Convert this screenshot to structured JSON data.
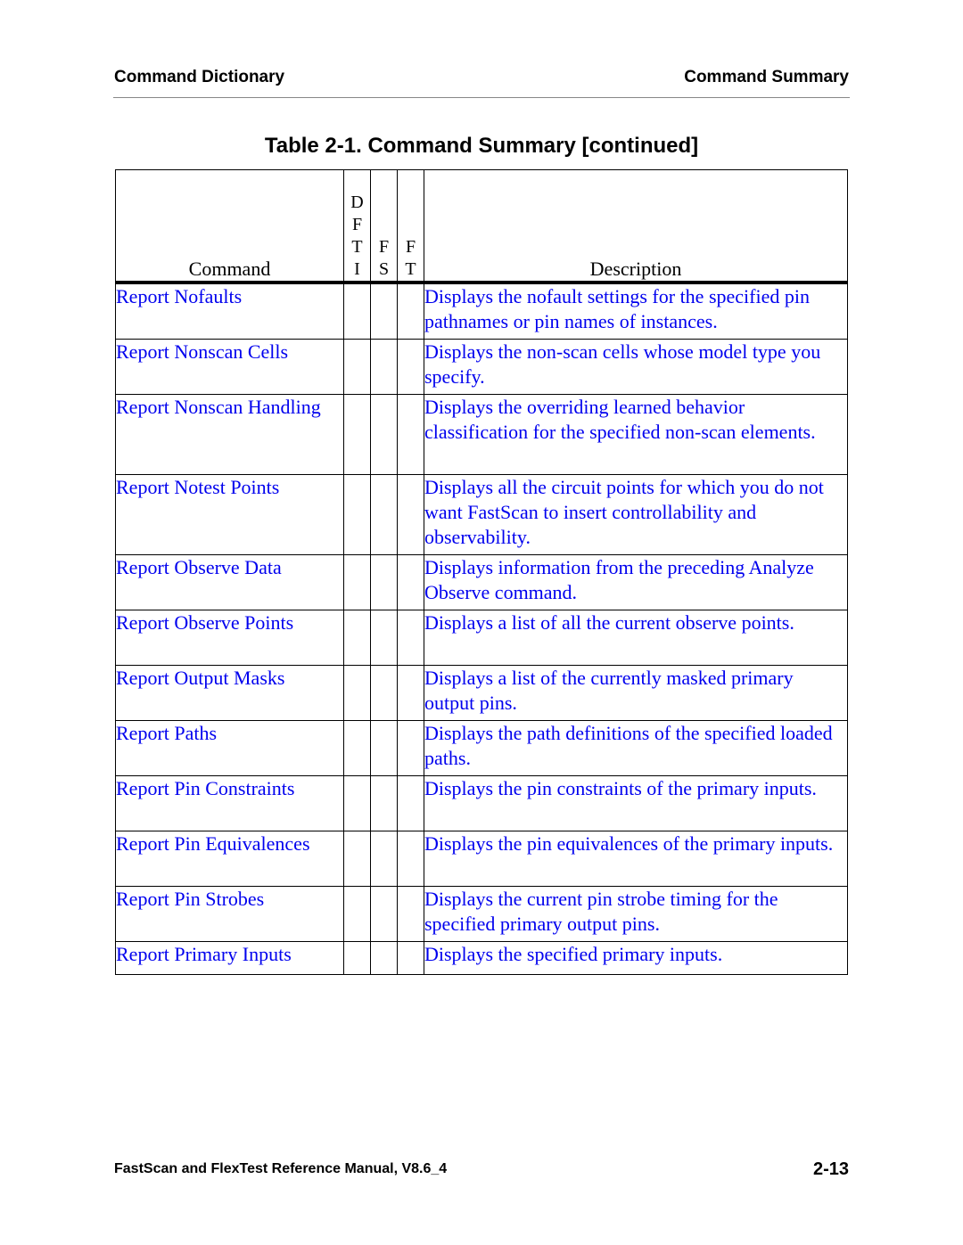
{
  "header": {
    "left": "Command Dictionary",
    "right": "Command Summary"
  },
  "caption": "Table 2-1. Command Summary [continued]",
  "table": {
    "columns": {
      "command": "Command",
      "dfti": [
        "D",
        "F",
        "T",
        "I"
      ],
      "fs": [
        "F",
        "S"
      ],
      "ft": [
        "F",
        "T"
      ],
      "description": "Description"
    },
    "rows": [
      {
        "command": "Report Nofaults",
        "dfti": "",
        "fs": "",
        "ft": "",
        "description": "Displays the nofault settings for the specified pin pathnames or pin names of instances."
      },
      {
        "command": "Report Nonscan Cells",
        "dfti": "",
        "fs": "",
        "ft": "",
        "description": "Displays the non-scan cells whose model type you specify."
      },
      {
        "command": "Report Nonscan Handling",
        "dfti": "",
        "fs": "",
        "ft": "",
        "description": "Displays the overriding learned behavior classification for the specified non-scan elements."
      },
      {
        "command": "Report Notest Points",
        "dfti": "",
        "fs": "",
        "ft": "",
        "description": "Displays all the circuit points for which you do not want FastScan to insert controllability and observability."
      },
      {
        "command": "Report Observe Data",
        "dfti": "",
        "fs": "",
        "ft": "",
        "description": "Displays information from the preceding Analyze Observe command."
      },
      {
        "command": "Report Observe Points",
        "dfti": "",
        "fs": "",
        "ft": "",
        "description": "Displays a list of all the current observe points."
      },
      {
        "command": "Report Output Masks",
        "dfti": "",
        "fs": "",
        "ft": "",
        "description": "Displays a list of the currently masked primary output pins."
      },
      {
        "command": "Report Paths",
        "dfti": "",
        "fs": "",
        "ft": "",
        "description": "Displays the path definitions of the specified loaded paths."
      },
      {
        "command": "Report Pin Constraints",
        "dfti": "",
        "fs": "",
        "ft": "",
        "description": "Displays the pin constraints of the primary inputs."
      },
      {
        "command": "Report Pin Equivalences",
        "dfti": "",
        "fs": "",
        "ft": "",
        "description": "Displays the pin equivalences of the primary inputs."
      },
      {
        "command": "Report Pin Strobes",
        "dfti": "",
        "fs": "",
        "ft": "",
        "description": "Displays the current pin strobe timing for the specified primary output pins."
      },
      {
        "command": "Report Primary Inputs",
        "dfti": "",
        "fs": "",
        "ft": "",
        "description": "Displays the specified primary inputs."
      }
    ]
  },
  "colors": {
    "link": "#0000ee",
    "text": "#000000"
  },
  "footer": {
    "left": "FastScan and FlexTest Reference Manual, V8.6_4",
    "right": "2-13"
  }
}
